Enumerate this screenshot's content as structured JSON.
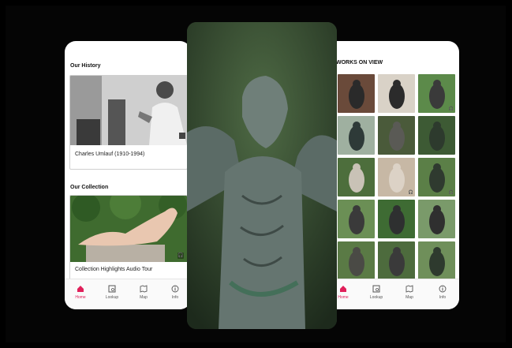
{
  "left_phone": {
    "history_title": "Our History",
    "history_caption": "Charles Umlauf (1910-1994)",
    "collection_title": "Our Collection",
    "collection_caption": "Collection Highlights Audio Tour"
  },
  "right_phone": {
    "works_title": "WORKS ON VIEW",
    "thumbnails": [
      {
        "name": "thumb-1",
        "badge": ""
      },
      {
        "name": "thumb-2",
        "badge": ""
      },
      {
        "name": "thumb-3",
        "badge": "🎧"
      },
      {
        "name": "thumb-4",
        "badge": ""
      },
      {
        "name": "thumb-5",
        "badge": ""
      },
      {
        "name": "thumb-6",
        "badge": ""
      },
      {
        "name": "thumb-7",
        "badge": ""
      },
      {
        "name": "thumb-8",
        "badge": "🎧"
      },
      {
        "name": "thumb-9",
        "badge": "🎧"
      },
      {
        "name": "thumb-10",
        "badge": ""
      },
      {
        "name": "thumb-11",
        "badge": ""
      },
      {
        "name": "thumb-12",
        "badge": ""
      },
      {
        "name": "thumb-13",
        "badge": ""
      },
      {
        "name": "thumb-14",
        "badge": ""
      },
      {
        "name": "thumb-15",
        "badge": ""
      }
    ]
  },
  "tabs": [
    {
      "label": "Home",
      "icon": "home-icon",
      "active": true
    },
    {
      "label": "Lookup",
      "icon": "lookup-icon",
      "active": false
    },
    {
      "label": "Map",
      "icon": "map-icon",
      "active": false
    },
    {
      "label": "Info",
      "icon": "info-icon",
      "active": false
    }
  ],
  "colors": {
    "accent": "#e0205a",
    "background": "#000000"
  }
}
